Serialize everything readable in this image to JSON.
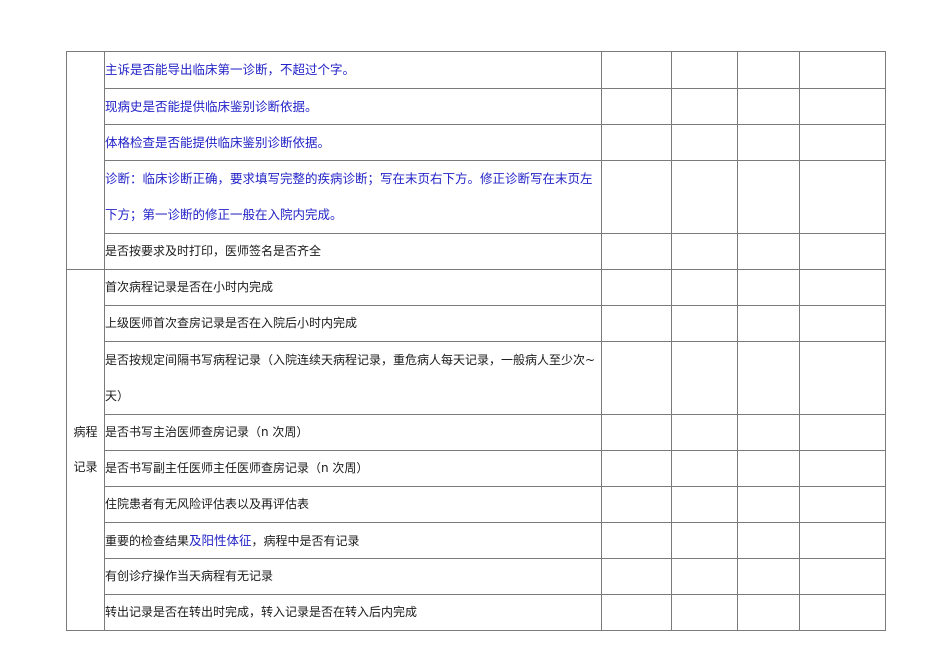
{
  "section_top": {
    "category": "",
    "items": [
      {
        "segments": [
          {
            "text": "主诉是否能导出临床第一诊断，不超过个字。",
            "style": "blue"
          }
        ]
      },
      {
        "segments": [
          {
            "text": "现病史是否能提供临床鉴别诊断依据。",
            "style": "blue"
          }
        ]
      },
      {
        "segments": [
          {
            "text": "体格检查是否能提供临床鉴别诊断依据。",
            "style": "blue"
          }
        ]
      },
      {
        "segments": [
          {
            "text": "诊断：临床诊断正确，要求填写完整的疾病诊断；写在末页右下方。修正诊断写在末页左下方；第一诊断的修正一般在入院内完成。",
            "style": "blue"
          }
        ]
      },
      {
        "segments": [
          {
            "text": "是否按要求及时打印，医师签名是否齐全",
            "style": "normal"
          }
        ]
      }
    ]
  },
  "section_bottom": {
    "category": "病程记录",
    "items": [
      {
        "segments": [
          {
            "text": "首次病程记录是否在小时内完成",
            "style": "normal"
          }
        ]
      },
      {
        "segments": [
          {
            "text": "上级医师首次查房记录是否在入院后小时内完成",
            "style": "normal"
          }
        ]
      },
      {
        "segments": [
          {
            "text": "是否按规定间隔书写病程记录（入院连续天病程记录，重危病人每天记录，一般病人至少次~天）",
            "style": "normal"
          }
        ]
      },
      {
        "segments": [
          {
            "text": "是否书写主治医师查房记录（n 次周）",
            "style": "normal"
          }
        ]
      },
      {
        "segments": [
          {
            "text": "是否书写副主任医师主任医师查房记录（n 次周）",
            "style": "normal"
          }
        ]
      },
      {
        "segments": [
          {
            "text": "住院患者有无风险评估表以及再评估表",
            "style": "normal"
          }
        ]
      },
      {
        "segments": [
          {
            "text": "重要的检查结果",
            "style": "normal"
          },
          {
            "text": "及阳性体征",
            "style": "blue"
          },
          {
            "text": "，病程中是否有记录",
            "style": "normal"
          }
        ]
      },
      {
        "segments": [
          {
            "text": "有创诊疗操作当天病程有无记录",
            "style": "normal"
          }
        ]
      },
      {
        "segments": [
          {
            "text": "转出记录是否在转出时完成，转入记录是否在转入后内完成",
            "style": "normal"
          }
        ]
      }
    ]
  }
}
